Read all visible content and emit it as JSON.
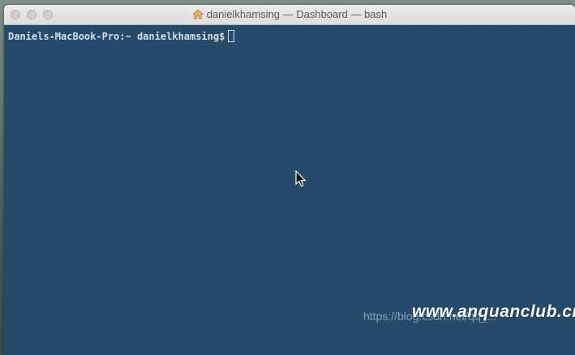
{
  "window": {
    "title": "danielkhamsing — Dashboard — bash",
    "title_icon": "home-icon"
  },
  "terminal": {
    "prompt": "Daniels-MacBook-Pro:~ danielkhamsing$",
    "command": "",
    "background_color": "#244a6b",
    "text_color": "#d7dde3"
  },
  "overlay": {
    "watermark_url": "https://blog.csdn.net/qq_...",
    "watermark_brand": "www.anquanclub.cn"
  }
}
